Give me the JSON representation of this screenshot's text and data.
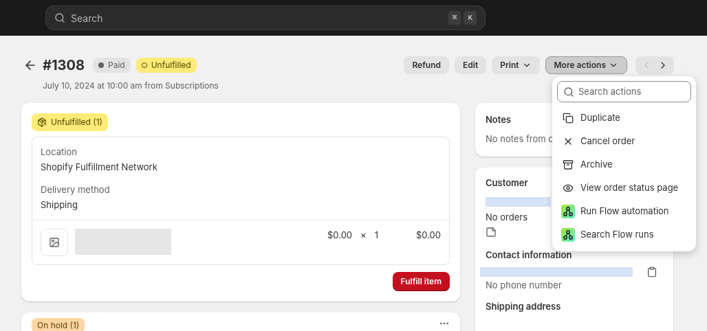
{
  "topbar": {
    "search": {
      "placeholder": "Search",
      "shortcut": [
        "⌘",
        "K"
      ]
    }
  },
  "header": {
    "title": "#1308",
    "badges": [
      {
        "label": "Paid",
        "kind": "payment"
      },
      {
        "label": "Unfulfilled",
        "kind": "fulfillment"
      }
    ],
    "subtitle": "July 10, 2024 at 10:00 am from Subscriptions"
  },
  "actions": [
    {
      "label": "Refund",
      "caret": false,
      "selected": false
    },
    {
      "label": "Edit",
      "caret": false,
      "selected": false
    },
    {
      "label": "Print",
      "caret": true,
      "selected": false
    },
    {
      "label": "More actions",
      "caret": true,
      "selected": true
    }
  ],
  "pager": {
    "previous_disabled": true,
    "next_disabled": false
  },
  "menu": {
    "search": {
      "placeholder": "Search actions"
    },
    "items": [
      {
        "label": "Duplicate",
        "kind": "duplicate"
      },
      {
        "label": "Cancel order",
        "kind": "cancel"
      },
      {
        "label": "Archive",
        "kind": "archive"
      },
      {
        "label": "View order status page",
        "kind": "view"
      },
      {
        "label": "Run Flow automation",
        "kind": "flow"
      },
      {
        "label": "Search Flow runs",
        "kind": "flow"
      }
    ]
  },
  "fulfillment_card": {
    "badge": "Unfulfilled (1)",
    "fields": [
      {
        "label": "Location",
        "value": "Shopify Fulfillment Network"
      },
      {
        "label": "Delivery method",
        "value": "Shipping"
      }
    ],
    "line_item": {
      "price": "$0.00",
      "times": "×",
      "quantity": "1",
      "total": "$0.00"
    },
    "button": "Fulfill item"
  },
  "hold_card": {
    "badge": "On hold (1)"
  },
  "notes": {
    "title": "Notes",
    "text": "No notes from c"
  },
  "customer": {
    "title": "Customer",
    "orders": "No orders",
    "contact_title": "Contact information",
    "phone": "No phone number",
    "shipping_title": "Shipping address"
  }
}
